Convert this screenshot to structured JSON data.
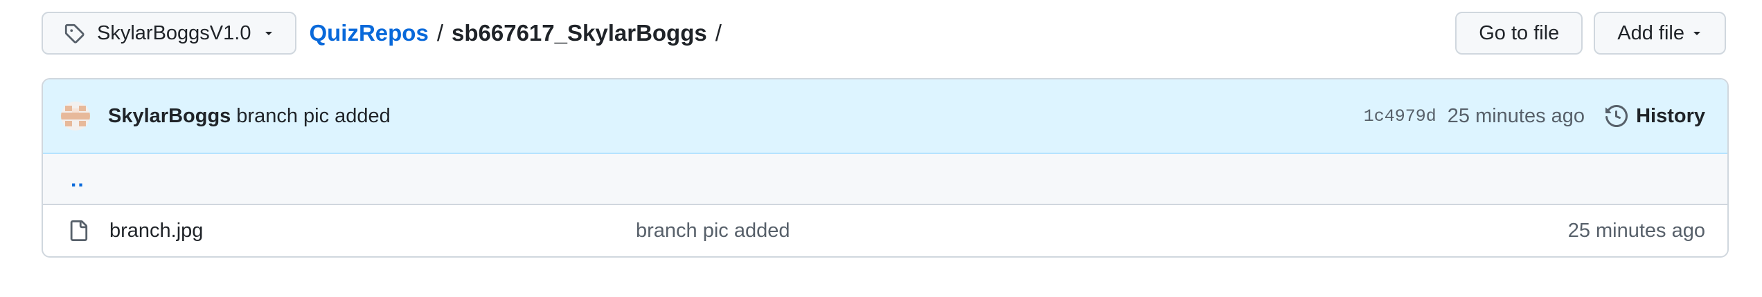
{
  "branch_selector": {
    "label": "SkylarBoggsV1.0",
    "icon": "tag-icon"
  },
  "breadcrumb": {
    "repo": "QuizRepos",
    "separator": "/",
    "directory": "sb667617_SkylarBoggs",
    "trailing_separator": "/"
  },
  "actions": {
    "go_to_file": "Go to file",
    "add_file": "Add file"
  },
  "latest_commit": {
    "author": "SkylarBoggs",
    "message": "branch pic added",
    "sha": "1c4979d",
    "time": "25 minutes ago",
    "history_label": "History"
  },
  "parent_dir": {
    "label": ".."
  },
  "files": [
    {
      "name": "branch.jpg",
      "commit_message": "branch pic added",
      "time": "25 minutes ago",
      "icon": "file-icon"
    }
  ],
  "colors": {
    "link": "#0969da",
    "commit_bar": "#ddf4ff",
    "border": "#d0d7de",
    "muted_text": "#57606a"
  }
}
